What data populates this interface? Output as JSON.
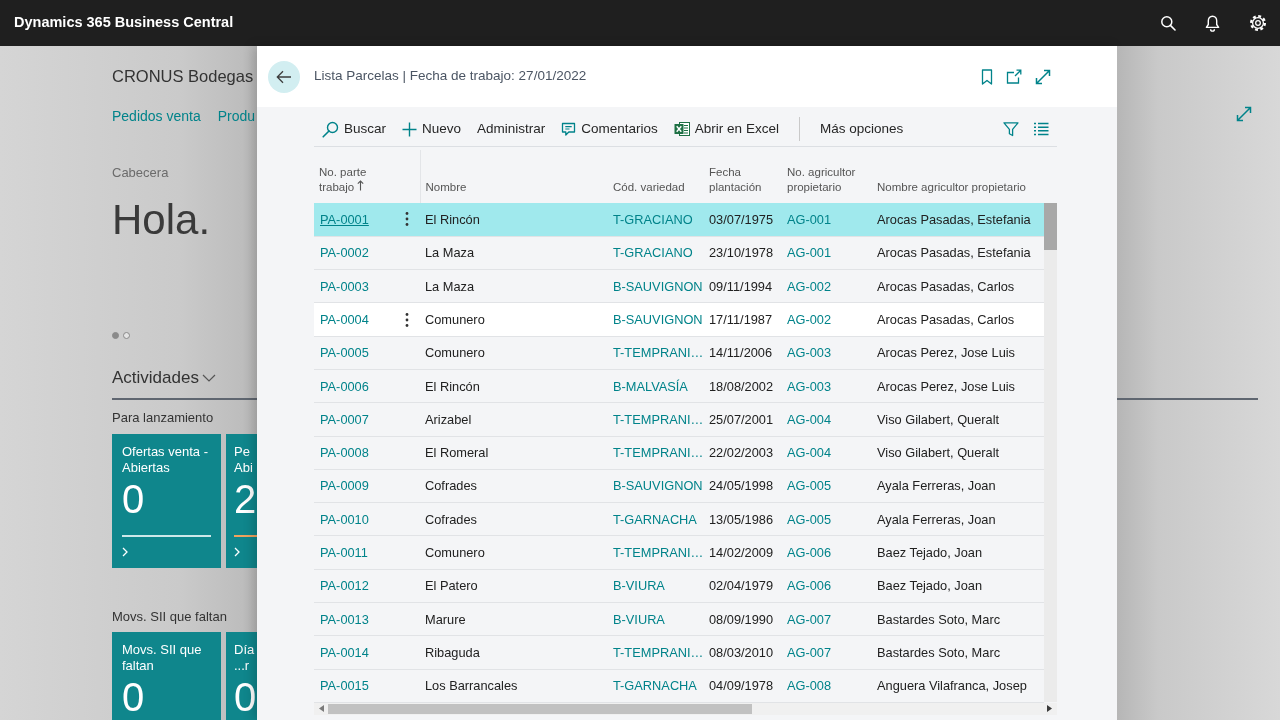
{
  "app_bar": {
    "title": "Dynamics 365 Business Central"
  },
  "background_page": {
    "company": "CRONUS Bodegas",
    "nav_links": [
      "Pedidos venta",
      "Produ"
    ],
    "section_label": "Cabecera",
    "greeting": "Hola.",
    "carousel_dots": [
      {
        "selected": true
      },
      {
        "selected": false
      }
    ],
    "activities_heading": "Actividades",
    "groups": [
      {
        "title": "Para lanzamiento",
        "tiles": [
          {
            "label_lines": [
              "Ofertas venta -",
              "Abiertas"
            ],
            "value": "0",
            "color": "#cde8e9"
          },
          {
            "label_lines": [
              "Pe",
              "Abi"
            ],
            "value": "2",
            "color": "#f0a35e"
          }
        ]
      },
      {
        "title": "Movs. SII que faltan",
        "tiles": [
          {
            "label_lines": [
              "Movs. SII que",
              "faltan"
            ],
            "value": "0"
          },
          {
            "label_lines": [
              "Día",
              "...r"
            ],
            "value": "0"
          }
        ]
      }
    ]
  },
  "dialog": {
    "title": "Lista Parcelas | Fecha de trabajo: 27/01/2022",
    "actions": [
      {
        "kind": "search",
        "label": "Buscar"
      },
      {
        "kind": "new",
        "label": "Nuevo"
      },
      {
        "kind": "plain",
        "label": "Administrar"
      },
      {
        "kind": "comments",
        "label": "Comentarios"
      },
      {
        "kind": "excel",
        "label": "Abrir en Excel"
      },
      {
        "kind": "more",
        "label": "Más opciones"
      }
    ],
    "table": {
      "columns": [
        {
          "label": "No. parte trabajo",
          "kind": "link",
          "sorted": true
        },
        {
          "label": "Nombre",
          "kind": "text",
          "sorted": false
        },
        {
          "label": "Cód. variedad",
          "kind": "link",
          "sorted": false
        },
        {
          "label": "Fecha plantación",
          "kind": "text",
          "sorted": false
        },
        {
          "label": "No. agricultor propietario",
          "kind": "link",
          "sorted": false
        },
        {
          "label": "Nombre agricultor propietario",
          "kind": "text",
          "sorted": false
        }
      ],
      "rows": [
        {
          "cells": [
            "PA-0001",
            "El Rincón",
            "T-GRACIANO",
            "03/07/1975",
            "AG-001",
            "Arocas Pasadas, Estefania"
          ],
          "selected": true,
          "hovered": false
        },
        {
          "cells": [
            "PA-0002",
            "La Maza",
            "T-GRACIANO",
            "23/10/1978",
            "AG-001",
            "Arocas Pasadas, Estefania"
          ],
          "selected": false,
          "hovered": false
        },
        {
          "cells": [
            "PA-0003",
            "La Maza",
            "B-SAUVIGNON",
            "09/11/1994",
            "AG-002",
            "Arocas Pasadas, Carlos"
          ],
          "selected": false,
          "hovered": false
        },
        {
          "cells": [
            "PA-0004",
            "Comunero",
            "B-SAUVIGNON",
            "17/11/1987",
            "AG-002",
            "Arocas Pasadas, Carlos"
          ],
          "selected": false,
          "hovered": true
        },
        {
          "cells": [
            "PA-0005",
            "Comunero",
            "T-TEMPRANI…",
            "14/11/2006",
            "AG-003",
            "Arocas Perez, Jose Luis"
          ],
          "selected": false,
          "hovered": false
        },
        {
          "cells": [
            "PA-0006",
            "El Rincón",
            "B-MALVASÍA",
            "18/08/2002",
            "AG-003",
            "Arocas Perez, Jose Luis"
          ],
          "selected": false,
          "hovered": false
        },
        {
          "cells": [
            "PA-0007",
            "Arizabel",
            "T-TEMPRANI…",
            "25/07/2001",
            "AG-004",
            "Viso Gilabert, Queralt"
          ],
          "selected": false,
          "hovered": false
        },
        {
          "cells": [
            "PA-0008",
            "El Romeral",
            "T-TEMPRANI…",
            "22/02/2003",
            "AG-004",
            "Viso Gilabert, Queralt"
          ],
          "selected": false,
          "hovered": false
        },
        {
          "cells": [
            "PA-0009",
            "Cofrades",
            "B-SAUVIGNON",
            "24/05/1998",
            "AG-005",
            "Ayala Ferreras, Joan"
          ],
          "selected": false,
          "hovered": false
        },
        {
          "cells": [
            "PA-0010",
            "Cofrades",
            "T-GARNACHA",
            "13/05/1986",
            "AG-005",
            "Ayala Ferreras, Joan"
          ],
          "selected": false,
          "hovered": false
        },
        {
          "cells": [
            "PA-0011",
            "Comunero",
            "T-TEMPRANI…",
            "14/02/2009",
            "AG-006",
            "Baez Tejado, Joan"
          ],
          "selected": false,
          "hovered": false
        },
        {
          "cells": [
            "PA-0012",
            "El Patero",
            "B-VIURA",
            "02/04/1979",
            "AG-006",
            "Baez Tejado, Joan"
          ],
          "selected": false,
          "hovered": false
        },
        {
          "cells": [
            "PA-0013",
            "Marure",
            "B-VIURA",
            "08/09/1990",
            "AG-007",
            "Bastardes Soto, Marc"
          ],
          "selected": false,
          "hovered": false
        },
        {
          "cells": [
            "PA-0014",
            "Ribaguda",
            "T-TEMPRANI…",
            "08/03/2010",
            "AG-007",
            "Bastardes Soto, Marc"
          ],
          "selected": false,
          "hovered": false
        },
        {
          "cells": [
            "PA-0015",
            "Los Barrancales",
            "T-GARNACHA",
            "04/09/1978",
            "AG-008",
            "Anguera Vilafranca, Josep"
          ],
          "selected": false,
          "hovered": false
        }
      ]
    }
  }
}
